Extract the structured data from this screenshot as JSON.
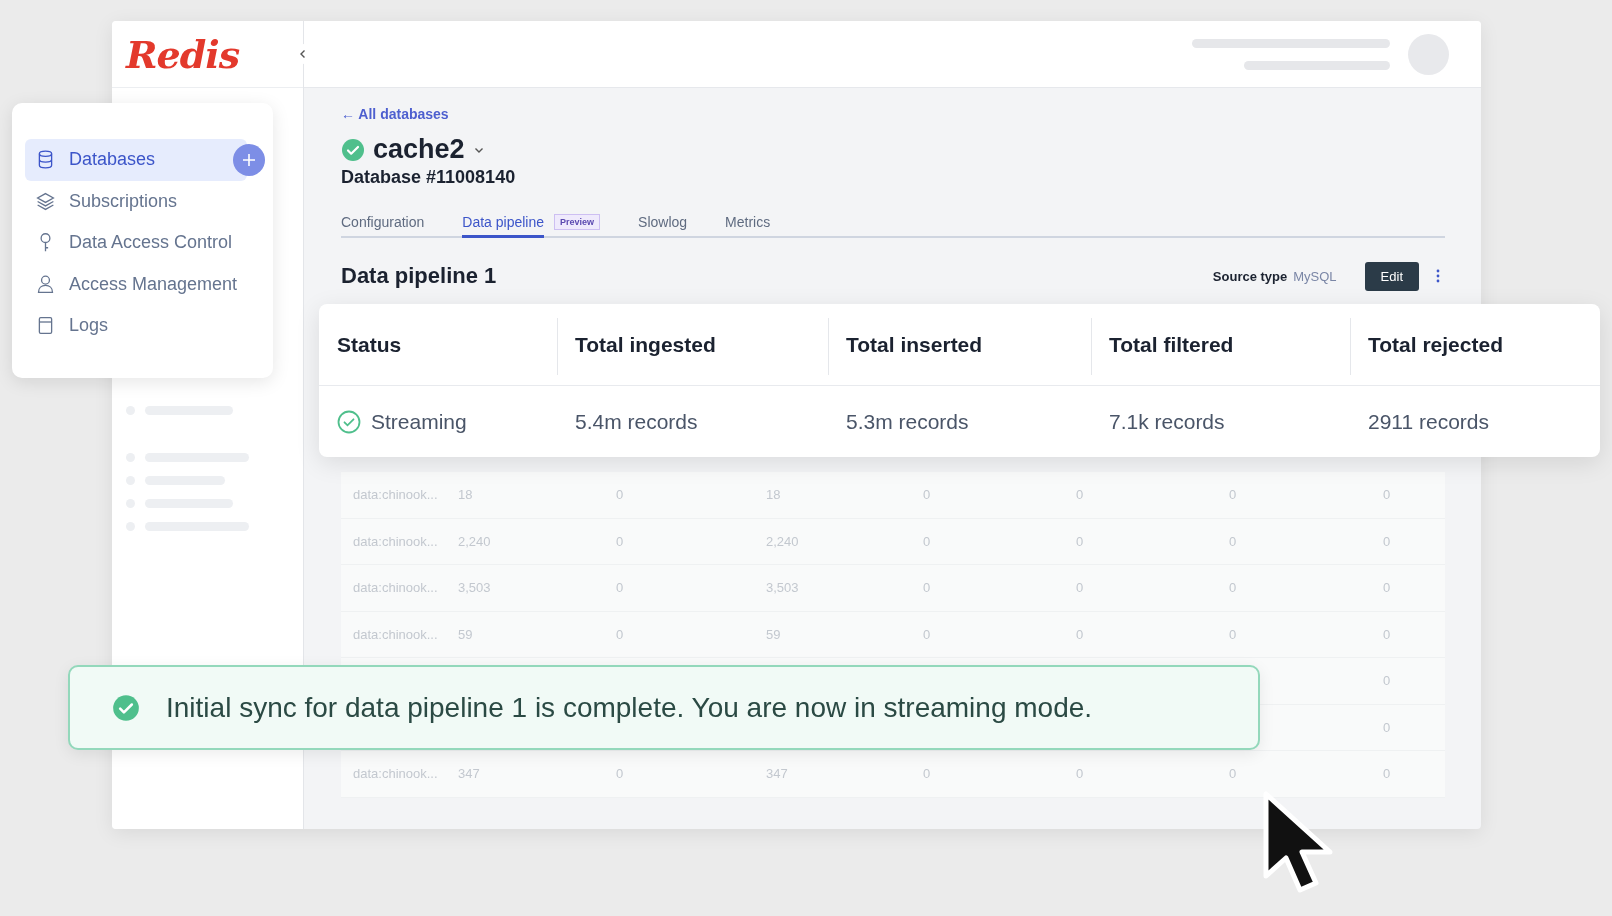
{
  "logo": "Redis",
  "sidebar": {
    "items": [
      {
        "label": "Databases",
        "selected": true
      },
      {
        "label": "Subscriptions",
        "selected": false
      },
      {
        "label": "Data Access Control",
        "selected": false
      },
      {
        "label": "Access Management",
        "selected": false
      },
      {
        "label": "Logs",
        "selected": false
      }
    ]
  },
  "back_link": "← All databases",
  "database": {
    "name": "cache2",
    "healthy": true,
    "id": "Database #11008140"
  },
  "tabs": [
    {
      "label": "Configuration",
      "selected": false
    },
    {
      "label": "Data pipeline",
      "selected": true,
      "badge": "Preview"
    },
    {
      "label": "Slowlog",
      "selected": false
    },
    {
      "label": "Metrics",
      "selected": false
    }
  ],
  "pipeline": {
    "title": "Data pipeline 1",
    "source_label": "Source type",
    "source_value": "MySQL",
    "edit_button": "Edit"
  },
  "stats": [
    {
      "kind": "status",
      "label": "Status",
      "value": "Streaming"
    },
    {
      "kind": "count",
      "label": "Total ingested",
      "value": "5.4m records"
    },
    {
      "kind": "count",
      "label": "Total inserted",
      "value": "5.3m records"
    },
    {
      "kind": "count",
      "label": "Total filtered",
      "value": "7.1k records"
    },
    {
      "kind": "count",
      "label": "Total rejected",
      "value": "2911 records"
    }
  ],
  "table": {
    "rows": [
      {
        "cells": [
          "data:chinook...",
          "18",
          "0",
          "18",
          "0",
          "0",
          "0",
          "0"
        ]
      },
      {
        "cells": [
          "data:chinook...",
          "2,240",
          "0",
          "2,240",
          "0",
          "0",
          "0",
          "0"
        ]
      },
      {
        "cells": [
          "data:chinook...",
          "3,503",
          "0",
          "3,503",
          "0",
          "0",
          "0",
          "0"
        ]
      },
      {
        "cells": [
          "data:chinook...",
          "59",
          "0",
          "59",
          "0",
          "0",
          "0",
          "0"
        ]
      },
      {
        "cells": [
          "0"
        ]
      },
      {
        "cells": [
          "0"
        ]
      },
      {
        "cells": [
          "data:chinook...",
          "347",
          "0",
          "347",
          "0",
          "0",
          "0",
          "0"
        ]
      }
    ]
  },
  "toast": {
    "kind": "success",
    "message": "Initial sync for data pipeline 1 is complete. You are now in streaming mode."
  }
}
